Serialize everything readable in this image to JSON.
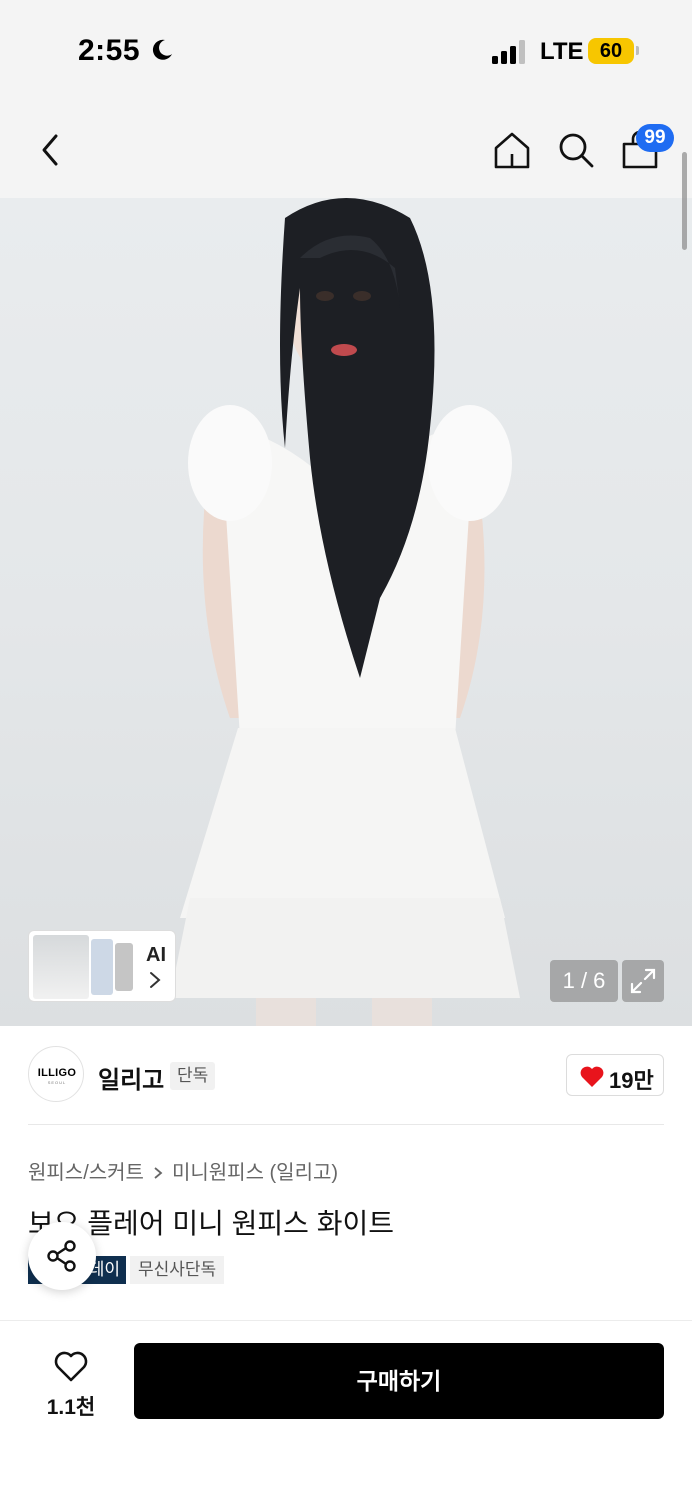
{
  "status_bar": {
    "time": "2:55",
    "network": "LTE",
    "battery": "60"
  },
  "nav": {
    "cart_count": "99"
  },
  "gallery": {
    "ai_label": "AI",
    "counter": "1 / 6"
  },
  "brand": {
    "logo_text": "ILLIGO",
    "logo_subtext": "SEOUL",
    "name": "일리고",
    "exclusive_tag": "단독",
    "like_count": "19만"
  },
  "product": {
    "breadcrumb": [
      "원피스/스커트",
      "미니원피스 (일리고)"
    ],
    "title": "보으 플레어 미니 원피스 화이트",
    "tags": [
      "데이",
      "무신사단독"
    ]
  },
  "bottom_bar": {
    "wish_count": "1.1천",
    "buy_label": "구매하기"
  },
  "colors": {
    "accent_blue": "#1f6cf2",
    "battery_yellow": "#f7c600",
    "heart_red": "#e8141c",
    "tag_navy": "#0f2f4f"
  }
}
